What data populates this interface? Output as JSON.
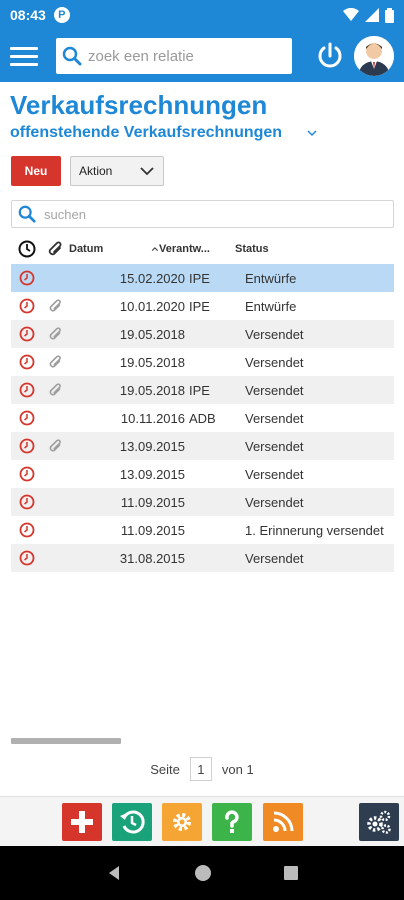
{
  "status_bar": {
    "time": "08:43",
    "badge": "P"
  },
  "header": {
    "search_placeholder": "zoek een relatie"
  },
  "page": {
    "title": "Verkaufsrechnungen",
    "filter": "offenstehende Verkaufsrechnungen",
    "new_button": "Neu",
    "action_dropdown": "Aktion",
    "search_placeholder": "suchen"
  },
  "table": {
    "columns": {
      "datum": "Datum",
      "verantwortlich": "Verantw...",
      "status": "Status"
    },
    "rows": [
      {
        "datum": "15.02.2020",
        "ver": "IPE",
        "status": "Entwürfe",
        "attachment": false,
        "selected": true
      },
      {
        "datum": "10.01.2020",
        "ver": "IPE",
        "status": "Entwürfe",
        "attachment": true
      },
      {
        "datum": "19.05.2018",
        "ver": "",
        "status": "Versendet",
        "attachment": true
      },
      {
        "datum": "19.05.2018",
        "ver": "",
        "status": "Versendet",
        "attachment": true
      },
      {
        "datum": "19.05.2018",
        "ver": "IPE",
        "status": "Versendet",
        "attachment": true
      },
      {
        "datum": "10.11.2016",
        "ver": "ADB",
        "status": "Versendet",
        "attachment": false
      },
      {
        "datum": "13.09.2015",
        "ver": "",
        "status": "Versendet",
        "attachment": true
      },
      {
        "datum": "13.09.2015",
        "ver": "",
        "status": "Versendet",
        "attachment": false
      },
      {
        "datum": "11.09.2015",
        "ver": "",
        "status": "Versendet",
        "attachment": false
      },
      {
        "datum": "11.09.2015",
        "ver": "",
        "status": "1. Erinnerung versendet",
        "attachment": false
      },
      {
        "datum": "31.08.2015",
        "ver": "",
        "status": "Versendet",
        "attachment": false
      }
    ]
  },
  "pager": {
    "label_page": "Seite",
    "current": "1",
    "label_of": "von 1"
  },
  "toolbar": {
    "buttons": [
      {
        "name": "add",
        "color": "#d6352c"
      },
      {
        "name": "history",
        "color": "#1aa37a"
      },
      {
        "name": "settings",
        "color": "#f4a534"
      },
      {
        "name": "help",
        "color": "#3cb44a"
      },
      {
        "name": "rss",
        "color": "#f08a24"
      },
      {
        "name": "admin-settings",
        "color": "#2e3e50"
      }
    ]
  },
  "colors": {
    "accent": "#1e88d6",
    "danger": "#d6352c",
    "selected_row": "#b9d9f5"
  }
}
